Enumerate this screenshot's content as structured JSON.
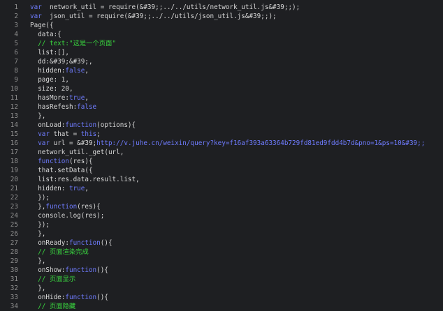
{
  "editor": {
    "lines": [
      {
        "num": "1",
        "segments": [
          [
            "kw",
            "var"
          ],
          [
            "",
            "  network_util = require("
          ],
          [
            "ent",
            "&#39;"
          ],
          [
            "",
            ";../../utils/network_util.js&#39;"
          ],
          [
            "",
            ";);"
          ]
        ]
      },
      {
        "num": "2",
        "segments": [
          [
            "kw",
            "var"
          ],
          [
            "",
            "  json_util = require("
          ],
          [
            "ent",
            "&#39;"
          ],
          [
            "",
            ";../../utils/json_util.js&#39;"
          ],
          [
            "",
            ";);"
          ]
        ]
      },
      {
        "num": "3",
        "segments": [
          [
            "",
            "Page({"
          ]
        ]
      },
      {
        "num": "4",
        "segments": [
          [
            "",
            "  data:{"
          ]
        ]
      },
      {
        "num": "5",
        "segments": [
          [
            "cm",
            "  // text:\"这是一个页面\""
          ]
        ]
      },
      {
        "num": "6",
        "segments": [
          [
            "",
            "  list:[],"
          ]
        ]
      },
      {
        "num": "7",
        "segments": [
          [
            "",
            "  dd:&#39;&#39;,"
          ]
        ]
      },
      {
        "num": "8",
        "segments": [
          [
            "",
            "  hidden:"
          ],
          [
            "bool",
            "false"
          ],
          [
            "",
            ","
          ]
        ]
      },
      {
        "num": "9",
        "segments": [
          [
            "",
            "  page: 1,"
          ]
        ]
      },
      {
        "num": "10",
        "segments": [
          [
            "",
            "  size: 20,"
          ]
        ]
      },
      {
        "num": "11",
        "segments": [
          [
            "",
            "  hasMore:"
          ],
          [
            "bool",
            "true"
          ],
          [
            "",
            ","
          ]
        ]
      },
      {
        "num": "12",
        "segments": [
          [
            "",
            "  hasRefesh:"
          ],
          [
            "bool",
            "false"
          ]
        ]
      },
      {
        "num": "13",
        "segments": [
          [
            "",
            "  },"
          ]
        ]
      },
      {
        "num": "14",
        "segments": [
          [
            "",
            "  onLoad:"
          ],
          [
            "kw",
            "function"
          ],
          [
            "",
            "(options){"
          ]
        ]
      },
      {
        "num": "15",
        "segments": [
          [
            "",
            "  "
          ],
          [
            "kw",
            "var"
          ],
          [
            "",
            " that = "
          ],
          [
            "kw",
            "this"
          ],
          [
            "",
            ";"
          ]
        ]
      },
      {
        "num": "16",
        "segments": [
          [
            "",
            "  "
          ],
          [
            "kw",
            "var"
          ],
          [
            "",
            " url = &#39;"
          ],
          [
            "url",
            "http://v.juhe.cn/weixin/query?key=f16af393a63364b729fd81ed9fdd4b7d&pno=1&ps=10&#39;;"
          ]
        ]
      },
      {
        "num": "17",
        "segments": [
          [
            "",
            "  network_util._get(url,"
          ]
        ]
      },
      {
        "num": "18",
        "segments": [
          [
            "",
            "  "
          ],
          [
            "kw",
            "function"
          ],
          [
            "",
            "(res){"
          ]
        ]
      },
      {
        "num": "19",
        "segments": [
          [
            "",
            "  that.setData({"
          ]
        ]
      },
      {
        "num": "20",
        "segments": [
          [
            "",
            "  list:res.data.result.list,"
          ]
        ]
      },
      {
        "num": "21",
        "segments": [
          [
            "",
            "  hidden: "
          ],
          [
            "bool",
            "true"
          ],
          [
            "",
            ","
          ]
        ]
      },
      {
        "num": "22",
        "segments": [
          [
            "",
            "  });"
          ]
        ]
      },
      {
        "num": "23",
        "segments": [
          [
            "",
            "  },"
          ],
          [
            "kw",
            "function"
          ],
          [
            "",
            "(res){"
          ]
        ]
      },
      {
        "num": "24",
        "segments": [
          [
            "",
            "  console.log(res);"
          ]
        ]
      },
      {
        "num": "25",
        "segments": [
          [
            "",
            "  });"
          ]
        ]
      },
      {
        "num": "26",
        "segments": [
          [
            "",
            "  },"
          ]
        ]
      },
      {
        "num": "27",
        "segments": [
          [
            "",
            "  onReady:"
          ],
          [
            "kw",
            "function"
          ],
          [
            "",
            "(){"
          ]
        ]
      },
      {
        "num": "28",
        "segments": [
          [
            "cm",
            "  // 页面渲染完成"
          ]
        ]
      },
      {
        "num": "29",
        "segments": [
          [
            "",
            "  },"
          ]
        ]
      },
      {
        "num": "30",
        "segments": [
          [
            "",
            "  onShow:"
          ],
          [
            "kw",
            "function"
          ],
          [
            "",
            "(){"
          ]
        ]
      },
      {
        "num": "31",
        "segments": [
          [
            "cm",
            "  // 页面显示"
          ]
        ]
      },
      {
        "num": "32",
        "segments": [
          [
            "",
            "  },"
          ]
        ]
      },
      {
        "num": "33",
        "segments": [
          [
            "",
            "  onHide:"
          ],
          [
            "kw",
            "function"
          ],
          [
            "",
            "(){"
          ]
        ]
      },
      {
        "num": "34",
        "segments": [
          [
            "cm",
            "  // 页面隐藏"
          ]
        ]
      }
    ]
  }
}
